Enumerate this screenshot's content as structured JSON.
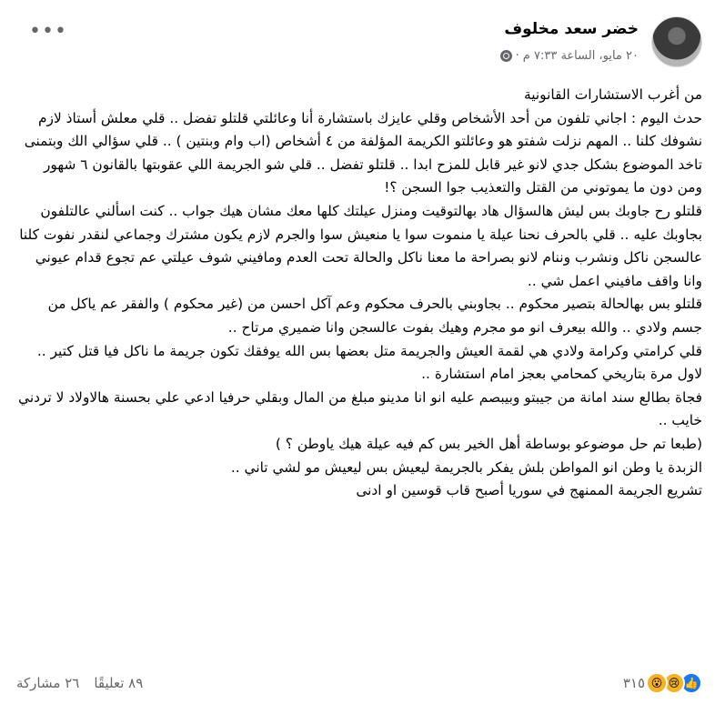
{
  "header": {
    "author": "خضر سعد مخلوف",
    "timestamp": "٢٠ مايو، الساعة ٧:٣٣ م",
    "separator": "·",
    "more_icon": "•••"
  },
  "post": {
    "paragraphs": [
      "من أغرب الاستشارات القانونية",
      "حدث اليوم : اجاني تلفون من أحد الأشخاص وقلي عايزك باستشارة أنا وعائلتي قلتلو تفضل .. قلي معلش أستاذ لازم نشوفك كلنا .. المهم نزلت شفتو هو وعائلتو الكريمة المؤلفة من ٤ أشخاص (اب وام وبنتين ) .. قلي سؤالي الك وبتمنى تاخد الموضوع بشكل جدي لانو غير قابل للمزح ابدا .. قلتلو تفضل .. قلي شو الجريمة اللي عقوبتها بالقانون ٦ شهور ومن دون ما يموتوني من القتل والتعذيب جوا السجن ؟!",
      "قلتلو رح جاوبك بس ليش هالسؤال هاد بهالتوقيت ومنزل عيلتك كلها معك مشان هيك جواب .. كنت اسألني عالتلفون بجاوبك عليه .. قلي بالحرف نحنا عيلة يا منموت سوا يا منعيش سوا والجرم لازم يكون مشترك وجماعي لنقدر نفوت كلنا عالسجن ناكل ونشرب وننام لانو بصراحة ما معنا ناكل والحالة تحت العدم ومافيني شوف عيلتي عم تجوع قدام عيوني وانا واقف مافيني اعمل شي ..",
      "قلتلو بس بهالحالة بتصير محكوم .. بجاوبني بالحرف محكوم وعم آكل احسن من (غير محكوم ) والفقر عم ياكل من جسم ولادي .. والله بيعرف انو مو مجرم وهيك بفوت عالسجن وانا ضميري مرتاح ..",
      "قلي كرامتي وكرامة ولادي هي لقمة العيش والجريمة متل بعضها بس الله يوفقك تكون جريمة ما ناكل فيا قتل كتير ..",
      "لاول مرة بتاريخي كمحامي بعجز امام استشارة ..",
      "فجاة بطالع سند امانة من جيبتو وبيبصم عليه انو انا مدينو مبلغ من المال وبقلي حرفيا ادعي علي بحسنة هالاولاد لا تردني خايب ..",
      "(طبعا تم حل موضوعو بوساطة أهل الخير بس كم فيه عيلة هيك ياوطن ؟ )",
      "الزبدة يا وطن انو المواطن بلش يفكر بالجريمة ليعيش بس ليعيش مو لشي تاني ..",
      "تشريع الجريمة الممنهج في سوريا أصبح قاب قوسين او ادنى"
    ]
  },
  "footer": {
    "reaction_count": "٣١٥",
    "comments": "٨٩ تعليقًا",
    "shares": "٢٦ مشاركة",
    "reaction_icons": [
      "like-icon",
      "sad-icon",
      "wow-icon"
    ]
  },
  "colors": {
    "text": "#050505",
    "secondary": "#65676b",
    "like": "#1877f2",
    "emoji": "#f7b125"
  }
}
